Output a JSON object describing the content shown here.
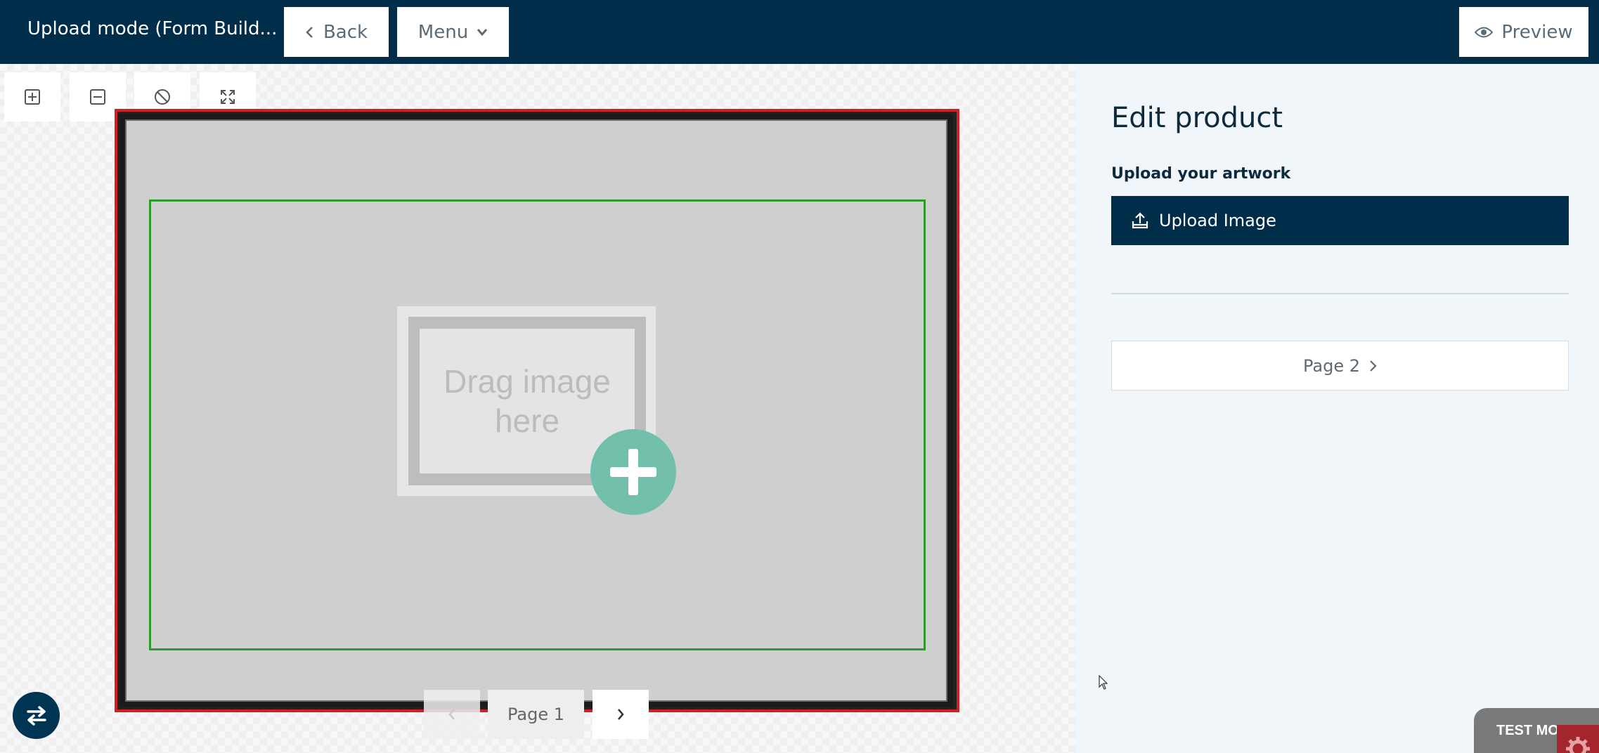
{
  "header": {
    "title": "Upload mode (Form Build...",
    "back_label": "Back",
    "menu_label": "Menu",
    "preview_label": "Preview"
  },
  "toolbar": {
    "tools": [
      {
        "name": "zoom-in-icon"
      },
      {
        "name": "zoom-out-icon"
      },
      {
        "name": "reset-icon"
      },
      {
        "name": "fullscreen-icon"
      }
    ]
  },
  "canvas": {
    "drop_text": "Drag image here",
    "page_label": "Page 1"
  },
  "panel": {
    "title": "Edit product",
    "upload_label": "Upload your artwork",
    "upload_button": "Upload Image",
    "page2_button": "Page 2"
  },
  "status": {
    "test_mode": "TEST MODE"
  },
  "colors": {
    "navy": "#002d4a",
    "bleed_red": "#d11f26",
    "safe_green": "#2e9a2e",
    "teal": "#72bfab"
  }
}
